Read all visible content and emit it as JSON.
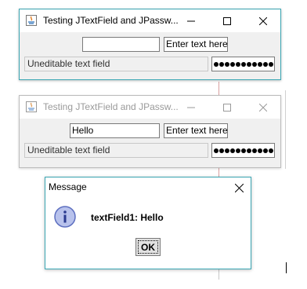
{
  "window1": {
    "title": "Testing JTextField and JPassw...",
    "text_field1_value": "",
    "text_field2_value": "Enter text here",
    "uneditable_field_value": "Uneditable text field",
    "password_dots": 11
  },
  "window2": {
    "title": "Testing JTextField and JPassw...",
    "text_field1_value": "Hello",
    "text_field2_value": "Enter text here",
    "uneditable_field_value": "Uneditable text field",
    "password_dots": 11
  },
  "dialog": {
    "title": "Message",
    "message": "textField1: Hello",
    "ok_label": "OK"
  },
  "colors": {
    "active_border": "#3aa6b3",
    "info_icon": "#8a9ad8"
  }
}
